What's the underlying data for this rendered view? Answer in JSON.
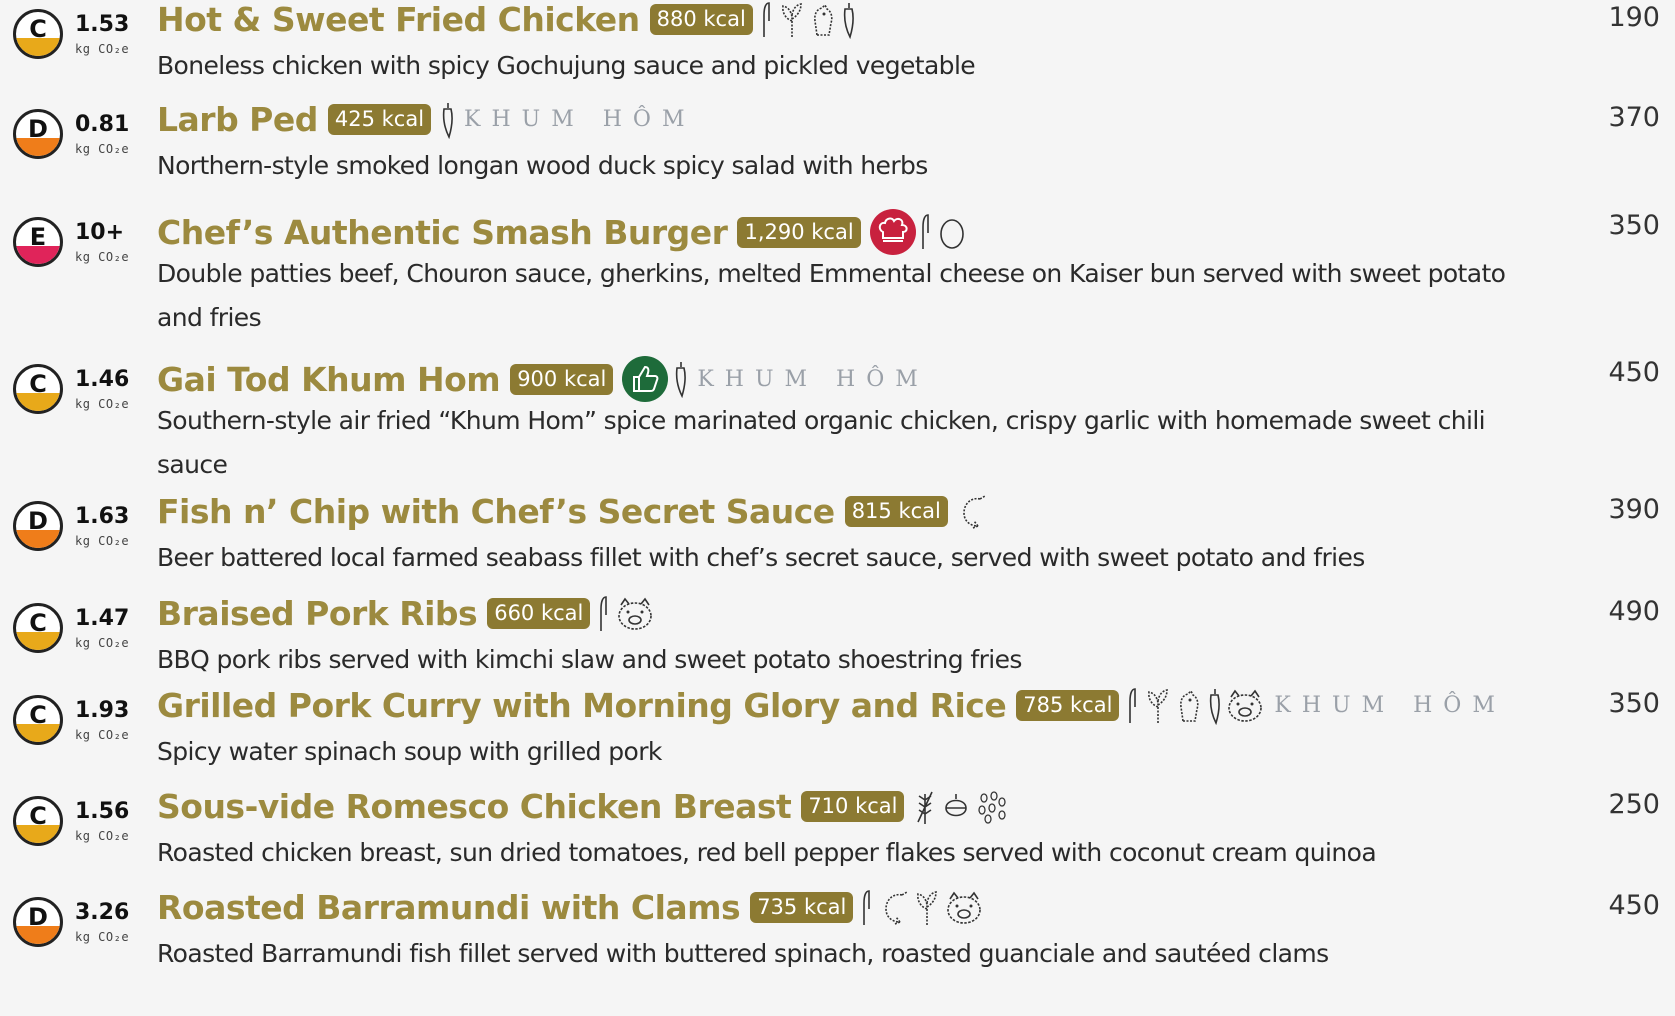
{
  "co2_unit": "kg CO₂e",
  "brand_mark": "KHUM HÔM",
  "grade_colors": {
    "C": "#e8a91a",
    "D": "#ef7d1a",
    "E": "#e0245a"
  },
  "accent_colors": {
    "title": "#9c8a3f",
    "kcal_badge": "#8c7a32"
  },
  "items": [
    {
      "grade": "C",
      "co2": "1.53",
      "name": "Hot & Sweet Fried Chicken",
      "kcal": "880 kcal",
      "price": "190",
      "description": "Boneless chicken with spicy Gochujung sauce and pickled vegetable",
      "icons": [
        "fork-icon",
        "vegetable-icon",
        "chicken-icon",
        "chili-icon"
      ]
    },
    {
      "grade": "D",
      "co2": "0.81",
      "name": "Larb Ped",
      "kcal": "425 kcal",
      "price": "370",
      "description": "Northern-style smoked longan wood duck spicy salad with herbs",
      "icons": [
        "chili-icon",
        "khum-hom-logo"
      ]
    },
    {
      "grade": "E",
      "co2": "10+",
      "name": "Chef’s Authentic Smash Burger",
      "kcal": "1,290 kcal",
      "price": "350",
      "description": "Double patties beef, Chouron sauce, gherkins, melted Emmental cheese on Kaiser bun served with sweet potato and fries",
      "icons": [
        "chef-hat-badge-icon",
        "fork-icon",
        "egg-icon"
      ]
    },
    {
      "grade": "C",
      "co2": "1.46",
      "name": "Gai Tod Khum Hom",
      "kcal": "900 kcal",
      "price": "450",
      "description": "Southern-style air fried “Khum Hom” spice marinated organic chicken, crispy garlic with homemade sweet chili sauce",
      "icons": [
        "thumbs-up-badge-icon",
        "chili-icon",
        "khum-hom-logo"
      ]
    },
    {
      "grade": "D",
      "co2": "1.63",
      "name": "Fish n’ Chip with Chef’s Secret Sauce",
      "kcal": "815 kcal",
      "price": "390",
      "description": "Beer battered local farmed seabass fillet with chef’s secret sauce, served with sweet potato and fries",
      "icons": [
        "shrimp-icon"
      ]
    },
    {
      "grade": "C",
      "co2": "1.47",
      "name": "Braised Pork Ribs",
      "kcal": "660 kcal",
      "price": "490",
      "description": "BBQ pork ribs served with kimchi slaw and sweet potato shoestring fries",
      "icons": [
        "fork-icon",
        "pig-icon"
      ]
    },
    {
      "grade": "C",
      "co2": "1.93",
      "name": "Grilled Pork Curry with Morning Glory and Rice",
      "kcal": "785 kcal",
      "price": "350",
      "description": "Spicy water spinach soup with grilled pork",
      "icons": [
        "fork-icon",
        "vegetable-icon",
        "chicken-icon",
        "chili-icon",
        "pig-icon",
        "khum-hom-logo"
      ]
    },
    {
      "grade": "C",
      "co2": "1.56",
      "name": "Sous-vide Romesco Chicken Breast",
      "kcal": "710 kcal",
      "price": "250",
      "description": "Roasted chicken breast, sun dried tomatoes, red bell pepper flakes served with coconut cream quinoa",
      "icons": [
        "wheat-icon",
        "nut-icon",
        "sesame-icon"
      ]
    },
    {
      "grade": "D",
      "co2": "3.26",
      "name": "Roasted Barramundi with Clams",
      "kcal": "735 kcal",
      "price": "450",
      "description": "Roasted Barramundi fish fillet served with buttered spinach, roasted guanciale and sautéed clams",
      "icons": [
        "fork-icon",
        "shrimp-icon",
        "vegetable-icon",
        "pig-icon"
      ]
    }
  ]
}
